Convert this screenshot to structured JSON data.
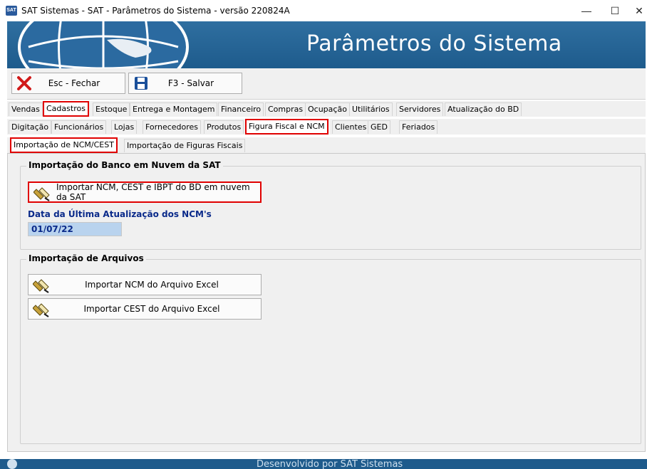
{
  "window": {
    "title": "SAT Sistemas - SAT - Parâmetros do Sistema - versão 220824A",
    "icon_text": "SAT",
    "minimize": "—",
    "maximize": "☐",
    "close": "✕"
  },
  "banner": {
    "title": "Parâmetros do Sistema"
  },
  "toolbar": {
    "close_label": "Esc - Fechar",
    "save_label": "F3 - Salvar"
  },
  "tabs_row1": [
    "Vendas",
    "Cadastros",
    "Estoque",
    "Entrega e Montagem",
    "Financeiro",
    "Compras",
    "Ocupação",
    "Utilitários",
    "Servidores",
    "Atualização do BD"
  ],
  "tabs_row2": [
    "Digitação",
    "Funcionários",
    "Lojas",
    "Fornecedores",
    "Produtos",
    "Figura Fiscal e NCM",
    "Clientes",
    "GED",
    "Feriados"
  ],
  "tabs_row3": [
    "Importação de NCM/CEST",
    "Importação de Figuras Fiscais"
  ],
  "active_tabs": {
    "row1": "Cadastros",
    "row2": "Figura Fiscal e NCM",
    "row3": "Importação de NCM/CEST"
  },
  "group_cloud": {
    "title": "Importação do Banco em Nuvem da SAT",
    "button_label": "Importar NCM, CEST e IBPT do BD em nuvem da SAT",
    "date_label": "Data da Última Atualização dos NCM's",
    "date_value": "01/07/22"
  },
  "group_files": {
    "title": "Importação de Arquivos",
    "ncm_button": "Importar NCM do Arquivo Excel",
    "cest_button": "Importar CEST do Arquivo Excel"
  },
  "footer": {
    "text": "Desenvolvido por SAT Sistemas"
  },
  "colors": {
    "banner": "#1e5b8c",
    "highlight": "#e00000",
    "date_field": "#b9d3ee",
    "label_blue": "#0a2a8a"
  }
}
